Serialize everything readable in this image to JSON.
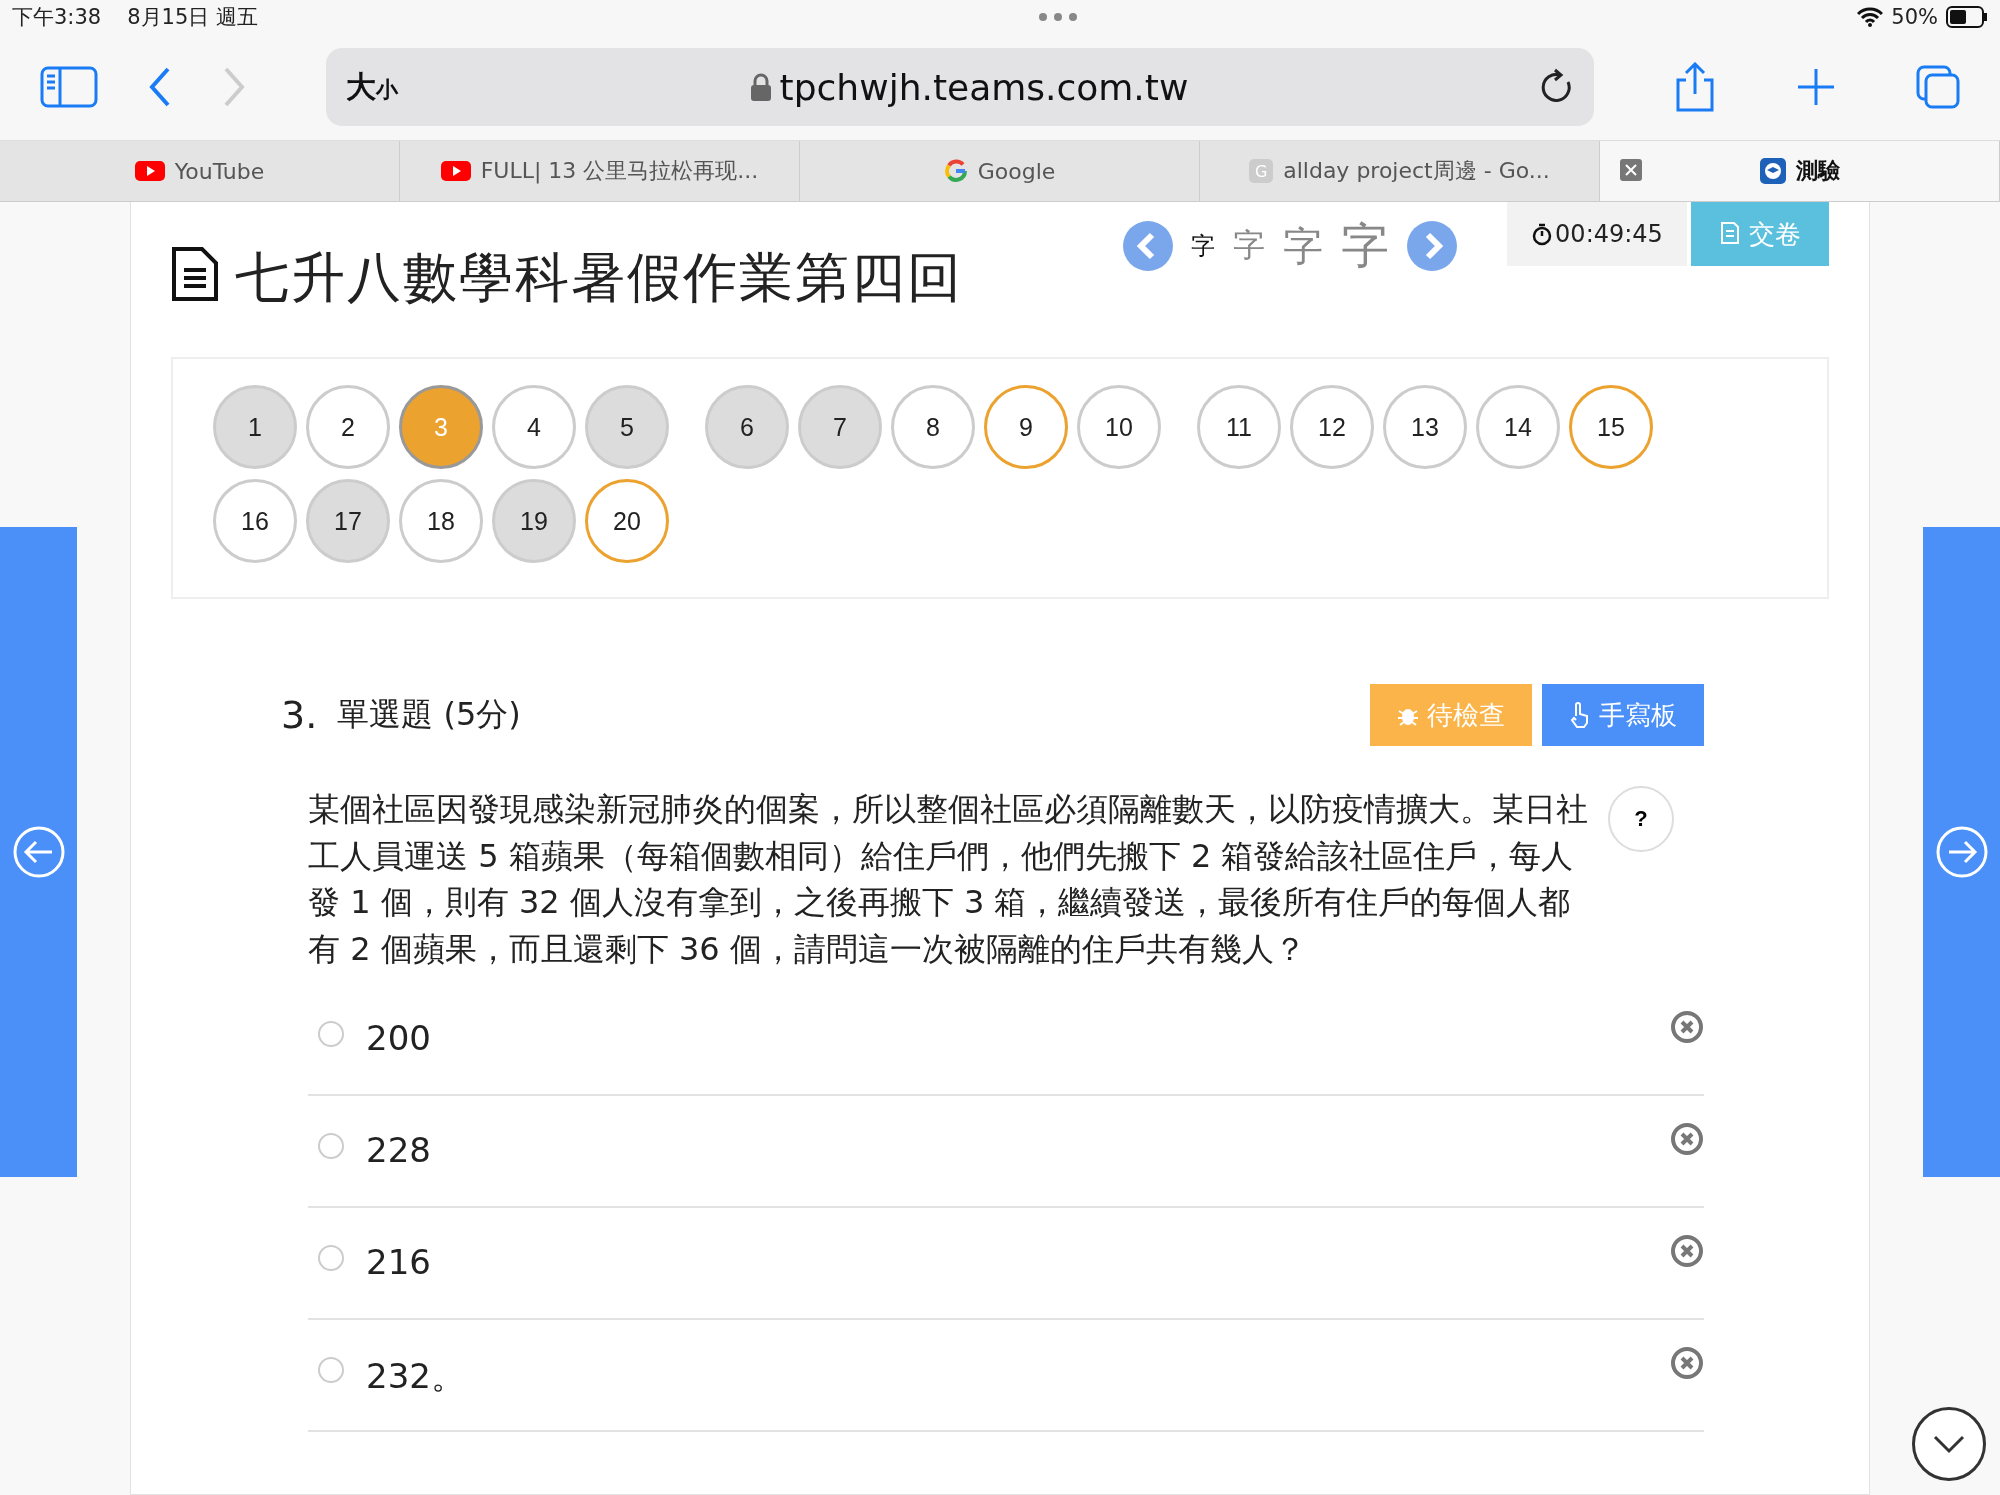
{
  "status_bar": {
    "time": "下午3:38",
    "date": "8月15日 週五",
    "battery": "50%"
  },
  "toolbar": {
    "back_disabled": false,
    "forward_disabled": true,
    "reader": {
      "large": "大",
      "small": "小"
    },
    "url": "tpchwjh.teams.com.tw"
  },
  "browser_tabs": [
    {
      "kind": "video",
      "title": "YouTube",
      "selected": false
    },
    {
      "kind": "video",
      "title": "FULL| 13 公里马拉松再现...",
      "selected": false
    },
    {
      "kind": "search",
      "title": "Google",
      "selected": false
    },
    {
      "kind": "letter",
      "favicon": "G",
      "title": "allday project周邊 - Go...",
      "selected": false
    },
    {
      "kind": "app",
      "title": "測驗",
      "selected": true
    }
  ],
  "header": {
    "title": "七升八數學科暑假作業第四回",
    "font_sizes": [
      {
        "label": "字",
        "selected": true
      },
      {
        "label": "字",
        "selected": false
      },
      {
        "label": "字",
        "selected": false
      },
      {
        "label": "字",
        "selected": false
      }
    ],
    "timer": "00:49:45",
    "submit": "交卷"
  },
  "question_nav": [
    {
      "label": "1",
      "answered": true,
      "flagged": false,
      "selected": false
    },
    {
      "label": "2",
      "answered": false,
      "flagged": false,
      "selected": false
    },
    {
      "label": "3",
      "answered": false,
      "flagged": false,
      "selected": true
    },
    {
      "label": "4",
      "answered": false,
      "flagged": false,
      "selected": false
    },
    {
      "label": "5",
      "answered": true,
      "flagged": false,
      "selected": false
    },
    {
      "label": "6",
      "answered": true,
      "flagged": false,
      "selected": false
    },
    {
      "label": "7",
      "answered": true,
      "flagged": false,
      "selected": false
    },
    {
      "label": "8",
      "answered": false,
      "flagged": false,
      "selected": false
    },
    {
      "label": "9",
      "answered": false,
      "flagged": true,
      "selected": false
    },
    {
      "label": "10",
      "answered": false,
      "flagged": false,
      "selected": false
    },
    {
      "label": "11",
      "answered": false,
      "flagged": false,
      "selected": false
    },
    {
      "label": "12",
      "answered": false,
      "flagged": false,
      "selected": false
    },
    {
      "label": "13",
      "answered": false,
      "flagged": false,
      "selected": false
    },
    {
      "label": "14",
      "answered": false,
      "flagged": false,
      "selected": false
    },
    {
      "label": "15",
      "answered": false,
      "flagged": true,
      "selected": false
    },
    {
      "label": "16",
      "answered": false,
      "flagged": false,
      "selected": false
    },
    {
      "label": "17",
      "answered": true,
      "flagged": false,
      "selected": false
    },
    {
      "label": "18",
      "answered": false,
      "flagged": false,
      "selected": false
    },
    {
      "label": "19",
      "answered": true,
      "flagged": false,
      "selected": false
    },
    {
      "label": "20",
      "answered": false,
      "flagged": true,
      "selected": false
    }
  ],
  "question": {
    "number": "3.",
    "type": "單選題 (5分)",
    "review_button": "待檢查",
    "handwriting_button": "手寫板",
    "help": "?",
    "text": "某個社區因發現感染新冠肺炎的個案，所以整個社區必須隔離數天，以防疫情擴大。某日社工人員運送 5 箱蘋果（每箱個數相同）給住戶們，他們先搬下 2 箱發給該社區住戶，每人發 1 個，則有 32 個人沒有拿到，之後再搬下 3 箱，繼續發送，最後所有住戶的每個人都有 2 個蘋果，而且還剩下 36 個，請問這一次被隔離的住戶共有幾人？",
    "options": [
      {
        "label": "200",
        "selected": false
      },
      {
        "label": "228",
        "selected": false
      },
      {
        "label": "216",
        "selected": false
      },
      {
        "label": "232。",
        "selected": false
      }
    ]
  }
}
